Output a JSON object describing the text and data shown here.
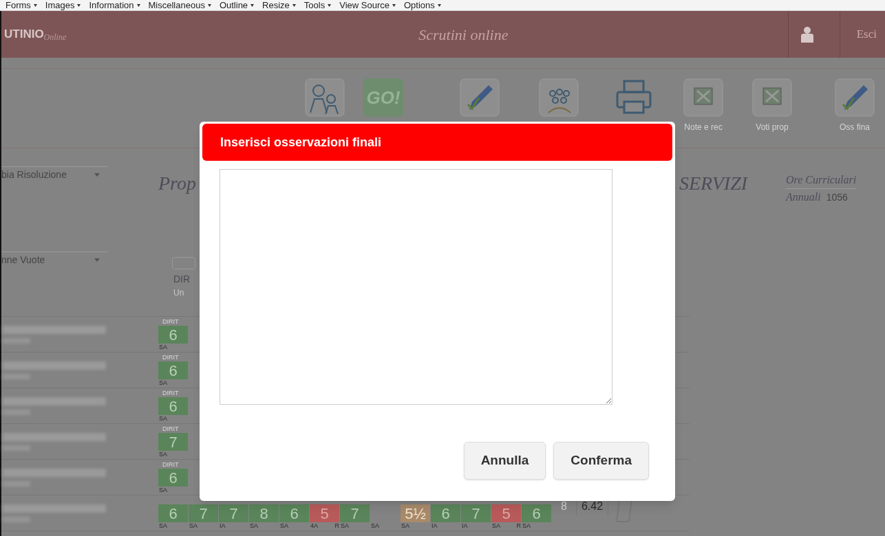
{
  "browser_toolbar": {
    "items": [
      {
        "label": "Forms"
      },
      {
        "label": "Images"
      },
      {
        "label": "Information"
      },
      {
        "label": "Miscellaneous"
      },
      {
        "label": "Outline"
      },
      {
        "label": "Resize"
      },
      {
        "label": "Tools"
      },
      {
        "label": "View Source"
      },
      {
        "label": "Options"
      }
    ]
  },
  "header": {
    "logo": "UTINIO",
    "logo_sub": "Online",
    "title": "Scrutini online",
    "logout": "Esci"
  },
  "tools": [
    {
      "kind": "people"
    },
    {
      "kind": "go",
      "label": "GO!"
    },
    {
      "kind": "pencil"
    },
    {
      "kind": "group"
    },
    {
      "kind": "printer"
    },
    {
      "kind": "sheet",
      "label": "Note e rec"
    },
    {
      "kind": "sheet",
      "label": "Voti prop"
    },
    {
      "kind": "pencil",
      "label": "Oss fina"
    }
  ],
  "filters": [
    {
      "value": "bia Risoluzione"
    },
    {
      "value": "nne Vuote"
    }
  ],
  "page_title_left": "Prop",
  "page_title_right": "SERVIZI",
  "hours": {
    "label1": "Ore Curriculari",
    "label2": "Annuali",
    "value": "1056"
  },
  "table": {
    "column": {
      "title": "DIR",
      "sub": "Un"
    },
    "rows": [
      {
        "grades": [
          {
            "subject": "DIRIT",
            "grade": "6",
            "note": "SA",
            "color": "#5a855a"
          }
        ]
      },
      {
        "grades": [
          {
            "subject": "DIRIT",
            "grade": "6",
            "note": "SA",
            "color": "#5a855a"
          }
        ]
      },
      {
        "grades": [
          {
            "subject": "DIRIT",
            "grade": "6",
            "note": "SA",
            "color": "#5a855a"
          }
        ]
      },
      {
        "grades": [
          {
            "subject": "DIRIT",
            "grade": "7",
            "note": "SA",
            "color": "#5a855a"
          }
        ]
      },
      {
        "grades": [
          {
            "subject": "DIRIT",
            "grade": "6",
            "note": "SA",
            "color": "#5a855a"
          }
        ]
      },
      {
        "grades": [
          {
            "grade": "6",
            "note": "SA",
            "color": "#5a855a"
          },
          {
            "grade": "7",
            "note": "SA",
            "color": "#5a855a"
          },
          {
            "grade": "7",
            "note": "IA",
            "color": "#5a855a"
          },
          {
            "grade": "8",
            "note": "SA",
            "color": "#5a855a"
          },
          {
            "grade": "6",
            "note": "SA",
            "color": "#5a855a"
          },
          {
            "grade": "5",
            "note": "4A",
            "flag": "R",
            "color": "#b85a5a"
          },
          {
            "grade": "7",
            "note": "SA",
            "color": "#5a855a"
          },
          {
            "note": "SA"
          },
          {
            "grade": "5½",
            "note": "SA",
            "color": "#a88a6a"
          },
          {
            "grade": "6",
            "note": "IA",
            "color": "#5a855a"
          },
          {
            "grade": "7",
            "note": "IA",
            "color": "#5a855a"
          },
          {
            "grade": "5",
            "note": "SA",
            "flag": "R",
            "color": "#b85a5a"
          },
          {
            "grade": "6",
            "note": "SA",
            "color": "#5a855a"
          }
        ],
        "conduct": "8",
        "average": "6.42"
      }
    ]
  },
  "modal": {
    "title": "Inserisci osservazioni finali",
    "buttons": [
      {
        "label": "Annulla"
      },
      {
        "label": "Conferma"
      }
    ]
  }
}
